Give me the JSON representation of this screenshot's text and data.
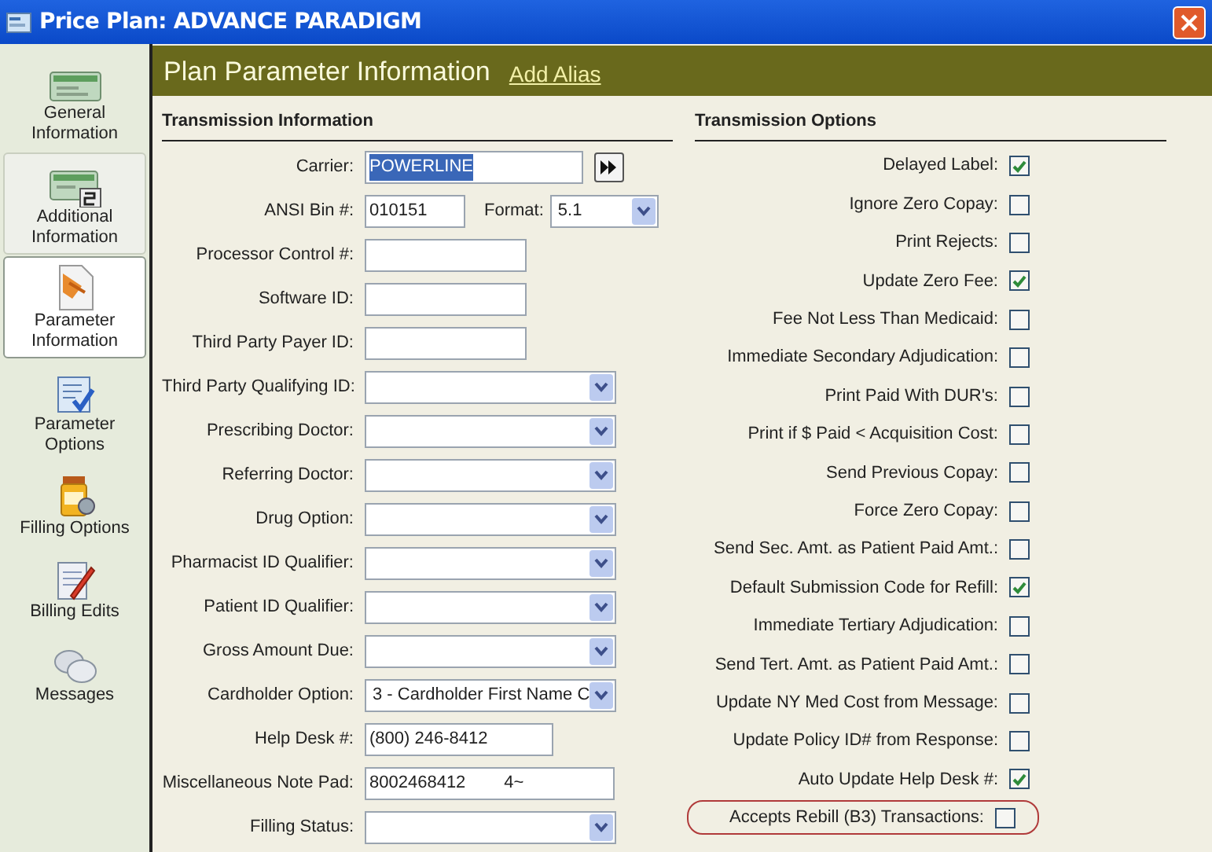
{
  "window": {
    "title": "Price Plan: ADVANCE PARADIGM"
  },
  "sidebar": {
    "items": [
      {
        "label": "General Information",
        "selected": false,
        "hovered": false
      },
      {
        "label": "Additional Information",
        "selected": false,
        "hovered": true
      },
      {
        "label": "Parameter Information",
        "selected": true,
        "hovered": false
      },
      {
        "label": "Parameter Options",
        "selected": false,
        "hovered": false
      },
      {
        "label": "Filling Options",
        "selected": false,
        "hovered": false
      },
      {
        "label": "Billing Edits",
        "selected": false,
        "hovered": false
      },
      {
        "label": "Messages",
        "selected": false,
        "hovered": false
      }
    ]
  },
  "header": {
    "title": "Plan Parameter Information",
    "link": "Add Alias"
  },
  "transmission_information": {
    "heading": "Transmission Information",
    "fields": [
      {
        "kind": "carrier",
        "label": "Carrier:",
        "value": "POWERLINE",
        "value_selected": true
      },
      {
        "kind": "ansi",
        "label": "ANSI Bin #:",
        "value": "010151",
        "format_label": "Format:",
        "format_value": "5.1"
      },
      {
        "kind": "text",
        "label": "Processor Control #:"
      },
      {
        "kind": "text",
        "label": "Software ID:"
      },
      {
        "kind": "text",
        "label": "Third Party Payer ID:"
      },
      {
        "kind": "combo",
        "label": "Third Party Qualifying ID:"
      },
      {
        "kind": "combo",
        "label": "Prescribing Doctor:"
      },
      {
        "kind": "combo",
        "label": "Referring Doctor:"
      },
      {
        "kind": "combo",
        "label": "Drug Option:"
      },
      {
        "kind": "combo",
        "label": "Pharmacist ID Qualifier:"
      },
      {
        "kind": "combo",
        "label": "Patient ID Qualifier:"
      },
      {
        "kind": "combo",
        "label": "Gross Amount Due:"
      },
      {
        "kind": "combo",
        "label": "Cardholder Option:",
        "value": "3 - Cardholder First Name C"
      },
      {
        "kind": "phone",
        "label": "Help Desk #:",
        "value": "(800) 246-8412"
      },
      {
        "kind": "note",
        "label": "Miscellaneous Note Pad:",
        "value": "8002468412        4~"
      },
      {
        "kind": "combo",
        "label": "Filling Status:"
      }
    ]
  },
  "transmission_options": {
    "heading": "Transmission Options",
    "options": [
      {
        "label": "Delayed Label:",
        "checked": true,
        "circled": false
      },
      {
        "label": "Ignore Zero Copay:",
        "checked": false,
        "circled": false
      },
      {
        "label": "Print Rejects:",
        "checked": false,
        "circled": false
      },
      {
        "label": "Update Zero Fee:",
        "checked": true,
        "circled": false
      },
      {
        "label": "Fee Not Less Than Medicaid:",
        "checked": false,
        "circled": false
      },
      {
        "label": "Immediate Secondary Adjudication:",
        "checked": false,
        "circled": false
      },
      {
        "label": "Print Paid With DUR's:",
        "checked": false,
        "circled": false
      },
      {
        "label": "Print if $ Paid < Acquisition Cost:",
        "checked": false,
        "circled": false
      },
      {
        "label": "Send Previous Copay:",
        "checked": false,
        "circled": false
      },
      {
        "label": "Force Zero Copay:",
        "checked": false,
        "circled": false
      },
      {
        "label": "Send Sec. Amt. as Patient Paid Amt.:",
        "checked": false,
        "circled": false
      },
      {
        "label": "Default Submission Code for Refill:",
        "checked": true,
        "circled": false
      },
      {
        "label": "Immediate Tertiary Adjudication:",
        "checked": false,
        "circled": false
      },
      {
        "label": "Send Tert. Amt. as Patient Paid Amt.:",
        "checked": false,
        "circled": false
      },
      {
        "label": "Update NY Med Cost from Message:",
        "checked": false,
        "circled": false
      },
      {
        "label": "Update Policy ID# from Response:",
        "checked": false,
        "circled": false
      },
      {
        "label": "Auto Update Help Desk #:",
        "checked": true,
        "circled": false
      },
      {
        "label": "Accepts Rebill (B3) Transactions:",
        "checked": false,
        "circled": true
      }
    ]
  }
}
